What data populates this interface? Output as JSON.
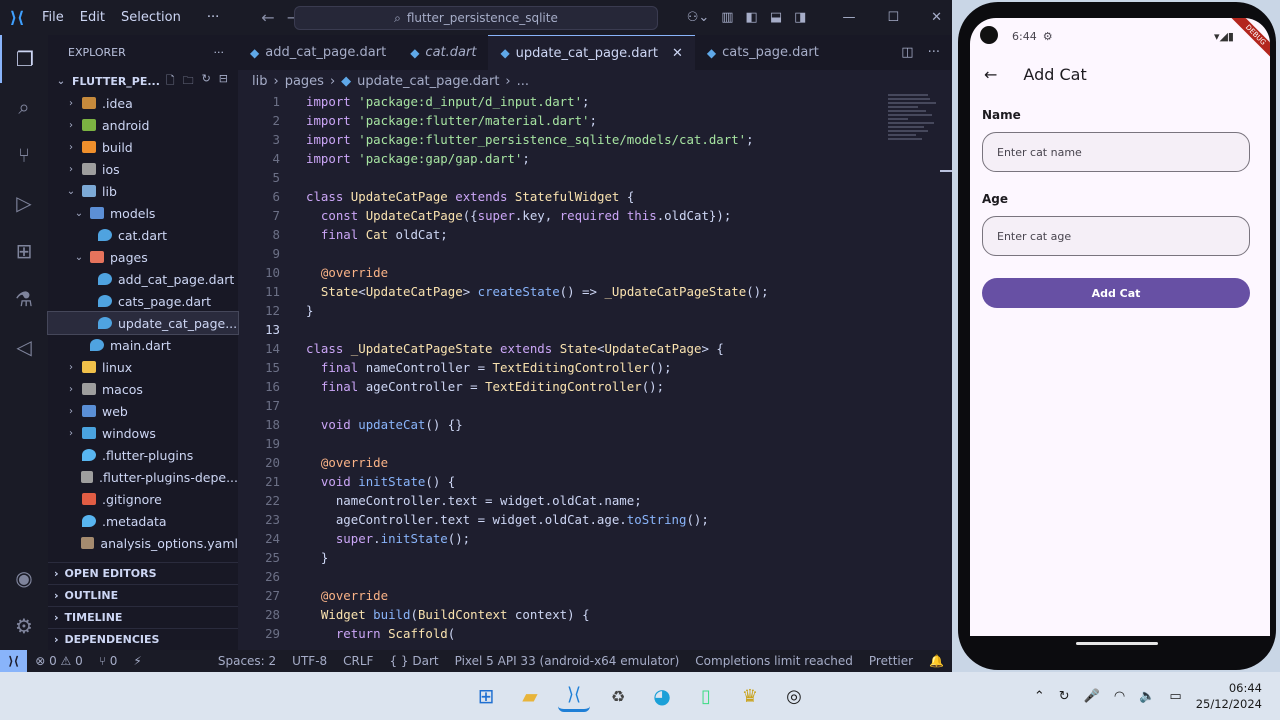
{
  "titlebar": {
    "menu": [
      "File",
      "Edit",
      "Selection",
      "···"
    ],
    "search": "flutter_persistence_sqlite"
  },
  "explorer": {
    "header": "EXPLORER",
    "project": "FLUTTER_PE...",
    "tree": [
      {
        "label": ".idea",
        "indent": 1,
        "chev": "›",
        "icon": "folder"
      },
      {
        "label": "android",
        "indent": 1,
        "chev": "›",
        "icon": "folder-android"
      },
      {
        "label": "build",
        "indent": 1,
        "chev": "›",
        "icon": "folder-build"
      },
      {
        "label": "ios",
        "indent": 1,
        "chev": "›",
        "icon": "folder-ios"
      },
      {
        "label": "lib",
        "indent": 1,
        "chev": "⌄",
        "icon": "folder-lib"
      },
      {
        "label": "models",
        "indent": 2,
        "chev": "⌄",
        "icon": "folder-models"
      },
      {
        "label": "cat.dart",
        "indent": 3,
        "chev": "",
        "icon": "dart"
      },
      {
        "label": "pages",
        "indent": 2,
        "chev": "⌄",
        "icon": "folder-pages"
      },
      {
        "label": "add_cat_page.dart",
        "indent": 3,
        "chev": "",
        "icon": "dart"
      },
      {
        "label": "cats_page.dart",
        "indent": 3,
        "chev": "",
        "icon": "dart"
      },
      {
        "label": "update_cat_page...",
        "indent": 3,
        "chev": "",
        "icon": "dart",
        "selected": true
      },
      {
        "label": "main.dart",
        "indent": 2,
        "chev": "",
        "icon": "dart"
      },
      {
        "label": "linux",
        "indent": 1,
        "chev": "›",
        "icon": "folder-linux"
      },
      {
        "label": "macos",
        "indent": 1,
        "chev": "›",
        "icon": "folder-macos"
      },
      {
        "label": "web",
        "indent": 1,
        "chev": "›",
        "icon": "folder-web"
      },
      {
        "label": "windows",
        "indent": 1,
        "chev": "›",
        "icon": "folder-windows"
      },
      {
        "label": ".flutter-plugins",
        "indent": 1,
        "chev": "",
        "icon": "flutter"
      },
      {
        "label": ".flutter-plugins-depe...",
        "indent": 1,
        "chev": "",
        "icon": "file"
      },
      {
        "label": ".gitignore",
        "indent": 1,
        "chev": "",
        "icon": "git"
      },
      {
        "label": ".metadata",
        "indent": 1,
        "chev": "",
        "icon": "flutter"
      },
      {
        "label": "analysis_options.yaml",
        "indent": 1,
        "chev": "",
        "icon": "yaml"
      }
    ],
    "sections": [
      "OPEN EDITORS",
      "OUTLINE",
      "TIMELINE",
      "DEPENDENCIES"
    ]
  },
  "tabs": [
    {
      "label": "add_cat_page.dart",
      "active": false,
      "italic": false
    },
    {
      "label": "cat.dart",
      "active": false,
      "italic": true
    },
    {
      "label": "update_cat_page.dart",
      "active": true,
      "italic": false
    },
    {
      "label": "cats_page.dart",
      "active": false,
      "italic": false
    }
  ],
  "breadcrumb": [
    "lib",
    "pages",
    "update_cat_page.dart",
    "..."
  ],
  "code": {
    "current_line": 13,
    "lines": [
      "import 'package:d_input/d_input.dart';",
      "import 'package:flutter/material.dart';",
      "import 'package:flutter_persistence_sqlite/models/cat.dart';",
      "import 'package:gap/gap.dart';",
      "",
      "class UpdateCatPage extends StatefulWidget {",
      "  const UpdateCatPage({super.key, required this.oldCat});",
      "  final Cat oldCat;",
      "",
      "  @override",
      "  State<UpdateCatPage> createState() => _UpdateCatPageState();",
      "}",
      "",
      "class _UpdateCatPageState extends State<UpdateCatPage> {",
      "  final nameController = TextEditingController();",
      "  final ageController = TextEditingController();",
      "",
      "  void updateCat() {}",
      "",
      "  @override",
      "  void initState() {",
      "    nameController.text = widget.oldCat.name;",
      "    ageController.text = widget.oldCat.age.toString();",
      "    super.initState();",
      "  }",
      "",
      "  @override",
      "  Widget build(BuildContext context) {",
      "    return Scaffold("
    ]
  },
  "statusbar": {
    "errors": "⊗ 0 ⚠ 0",
    "ports": "⑂ 0",
    "spaces": "Spaces: 2",
    "encoding": "UTF-8",
    "eol": "CRLF",
    "language": "{ } Dart",
    "device": "Pixel 5 API 33 (android-x64 emulator)",
    "completions": "Completions limit reached",
    "formatter": "Prettier"
  },
  "phone": {
    "time": "6:44",
    "debug": "DEBUG",
    "title": "Add Cat",
    "name_label": "Name",
    "name_placeholder": "Enter cat name",
    "age_label": "Age",
    "age_placeholder": "Enter cat age",
    "button": "Add Cat"
  },
  "taskbar": {
    "time": "06:44",
    "date": "25/12/2024"
  },
  "colors": {
    "accent": "#89b4fa",
    "button_purple": "#6750a4"
  }
}
